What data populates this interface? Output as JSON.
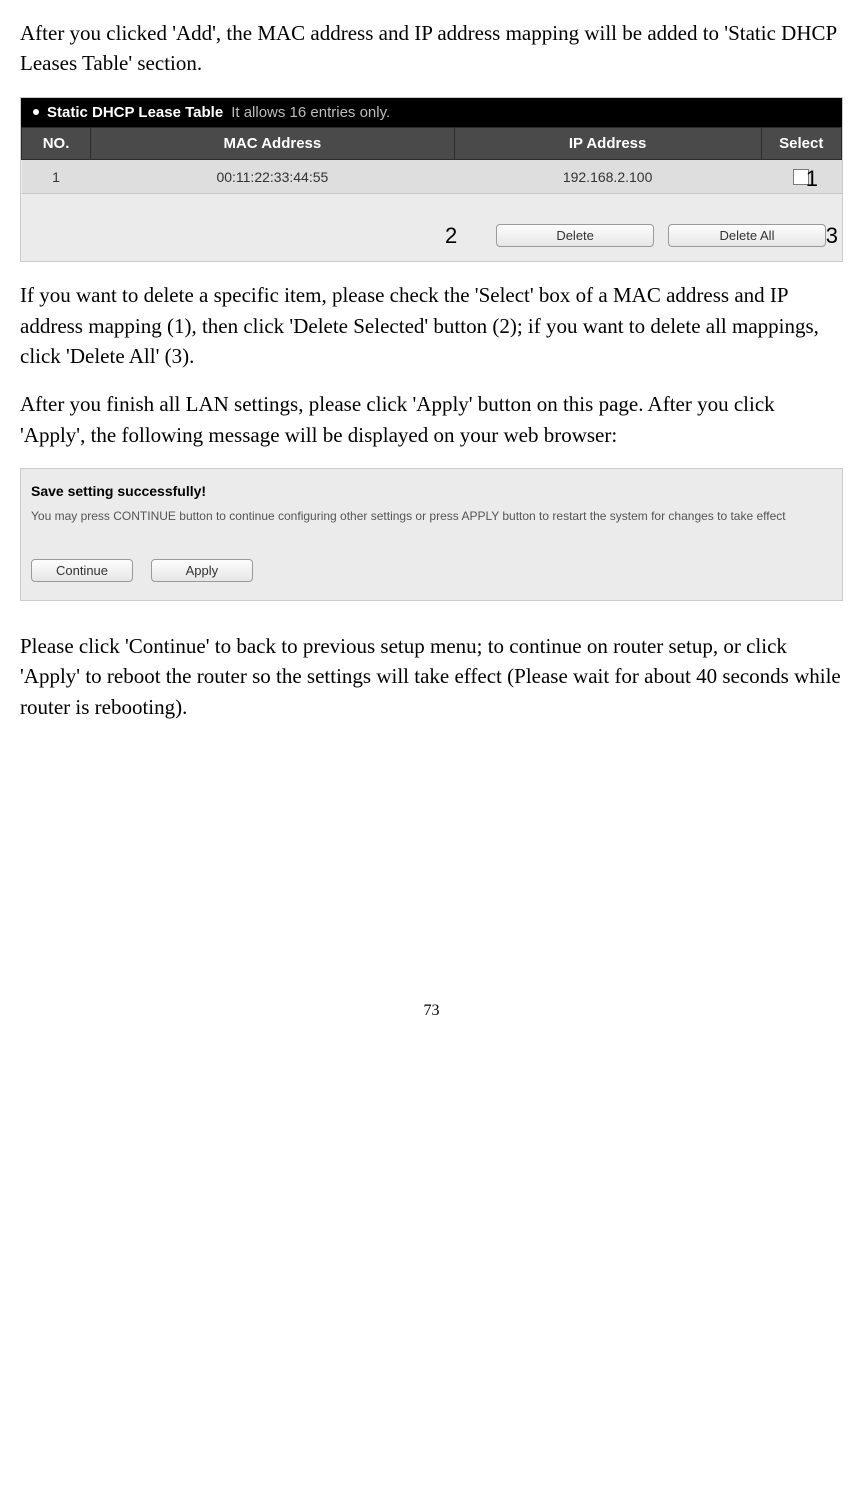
{
  "intro_paragraph": "After you clicked 'Add', the MAC address and IP address mapping will be added to 'Static DHCP Leases Table' section.",
  "dhcp_panel": {
    "title": "Static DHCP Lease Table",
    "hint": "It allows 16 entries only.",
    "headers": {
      "no": "NO.",
      "mac": "MAC Address",
      "ip": "IP Address",
      "select": "Select"
    },
    "row": {
      "no": "1",
      "mac": "00:11:22:33:44:55",
      "ip": "192.168.2.100"
    },
    "buttons": {
      "delete": "Delete",
      "delete_all": "Delete All"
    },
    "annotations": {
      "a1": "1",
      "a2": "2",
      "a3": "3"
    }
  },
  "delete_paragraph": "If you want to delete a specific item, please check the 'Select' box of a MAC address and IP address mapping (1), then click 'Delete Selected' button (2); if you want to delete all mappings, click 'Delete All' (3).",
  "apply_paragraph": "After you finish all LAN settings, please click 'Apply' button on this page. After you click 'Apply', the following message will be displayed on your web browser:",
  "save_panel": {
    "title": "Save setting successfully!",
    "message": "You may press CONTINUE button to continue configuring other settings or press APPLY button to restart the system for changes to take effect",
    "buttons": {
      "continue": "Continue",
      "apply": "Apply"
    }
  },
  "final_paragraph": "Please click 'Continue' to back to previous setup menu; to continue on router setup, or click 'Apply' to reboot the router so the settings will take effect (Please wait for about 40 seconds while router is rebooting).",
  "page_number": "73"
}
